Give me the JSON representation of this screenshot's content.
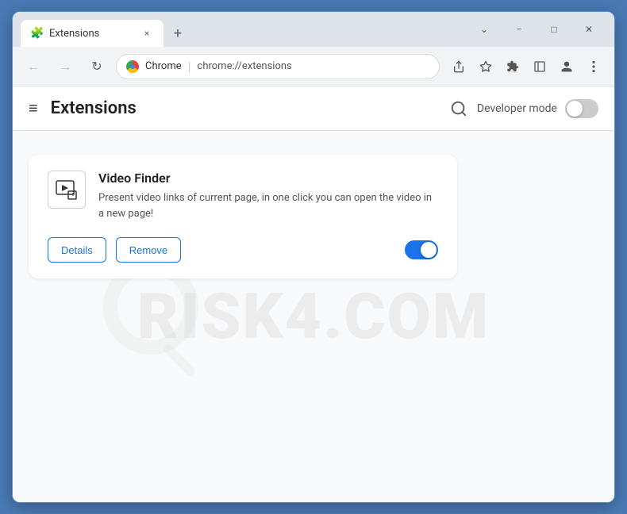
{
  "browser": {
    "tab": {
      "title": "Extensions",
      "favicon": "🧩",
      "close_label": "×"
    },
    "tab_new_label": "+",
    "window_controls": {
      "chevron_down": "⌄",
      "minimize": "−",
      "maximize": "□",
      "close": "✕"
    },
    "nav": {
      "back_label": "←",
      "forward_label": "→",
      "reload_label": "↻"
    },
    "address_bar": {
      "site_name": "Chrome",
      "url": "chrome://extensions"
    },
    "toolbar_icons": {
      "share": "↑",
      "bookmark": "☆",
      "extensions": "🧩",
      "sidebar": "▭",
      "profile": "◯",
      "menu": "⋮"
    }
  },
  "extensions_page": {
    "header": {
      "menu_icon": "≡",
      "title": "Extensions",
      "search_icon": "🔍",
      "dev_mode_label": "Developer mode"
    },
    "watermark_text": "RISK4.COM",
    "extension_card": {
      "name": "Video Finder",
      "description": "Present video links of current page, in one click you can open the video in a new page!",
      "details_label": "Details",
      "remove_label": "Remove",
      "enabled": true
    }
  }
}
